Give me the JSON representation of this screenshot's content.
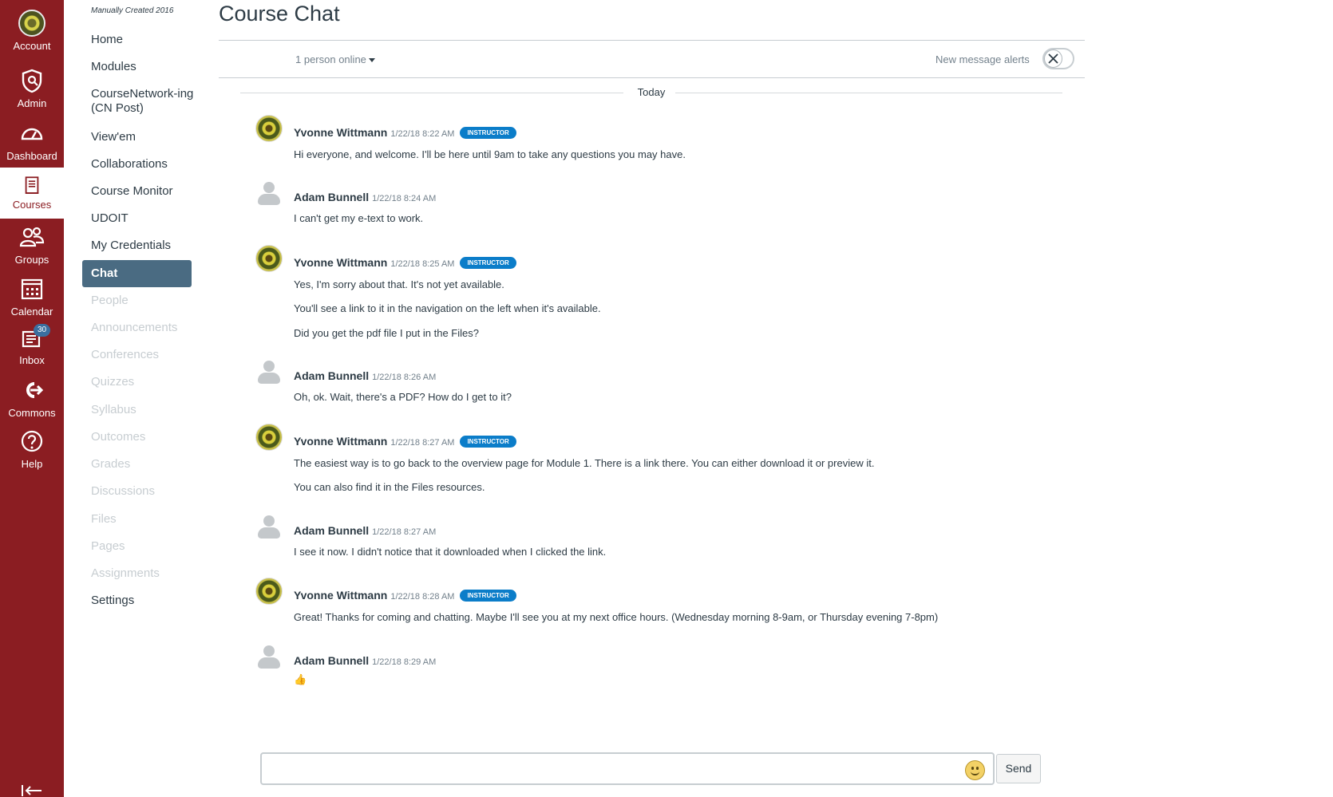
{
  "global_nav": {
    "items": [
      {
        "label": "Account",
        "icon": "account-avatar"
      },
      {
        "label": "Admin",
        "icon": "shield-icon"
      },
      {
        "label": "Dashboard",
        "icon": "dashboard-icon"
      },
      {
        "label": "Courses",
        "icon": "book-icon"
      },
      {
        "label": "Groups",
        "icon": "groups-icon"
      },
      {
        "label": "Calendar",
        "icon": "calendar-icon"
      },
      {
        "label": "Inbox",
        "icon": "inbox-icon",
        "badge": "30"
      },
      {
        "label": "Commons",
        "icon": "commons-icon"
      },
      {
        "label": "Help",
        "icon": "help-icon"
      }
    ],
    "active": "Courses",
    "color": "#8b1d22"
  },
  "course_nav": {
    "caption": "Manually Created 2016",
    "items": [
      {
        "label": "Home"
      },
      {
        "label": "Modules"
      },
      {
        "label": "CourseNetwork-ing (CN Post)"
      },
      {
        "label": "View'em"
      },
      {
        "label": "Collaborations"
      },
      {
        "label": "Course Monitor"
      },
      {
        "label": "UDOIT"
      },
      {
        "label": "My Credentials"
      },
      {
        "label": "Chat"
      },
      {
        "label": "People"
      },
      {
        "label": "Announcements"
      },
      {
        "label": "Conferences"
      },
      {
        "label": "Quizzes"
      },
      {
        "label": "Syllabus"
      },
      {
        "label": "Outcomes"
      },
      {
        "label": "Grades"
      },
      {
        "label": "Discussions"
      },
      {
        "label": "Files"
      },
      {
        "label": "Pages"
      },
      {
        "label": "Assignments"
      },
      {
        "label": "Settings"
      }
    ],
    "active": "Chat",
    "active_color": "#4a6b82"
  },
  "chat": {
    "title": "Course Chat",
    "online": "1 person online",
    "alerts_label": "New message alerts",
    "day_divider": "Today",
    "messages": [
      {
        "name": "Yvonne Wittmann",
        "time": "1/22/18 8:22 AM",
        "role": "INSTRUCTOR",
        "lines": [
          "Hi everyone, and welcome. I'll be here until 9am to take any questions you may have."
        ]
      },
      {
        "name": "Adam Bunnell",
        "time": "1/22/18 8:24 AM",
        "role": "",
        "lines": [
          "I can't get my e-text to work."
        ]
      },
      {
        "name": "Yvonne Wittmann",
        "time": "1/22/18 8:25 AM",
        "role": "INSTRUCTOR",
        "lines": [
          "Yes, I'm sorry about that. It's not yet available.",
          "You'll see a link to it in the navigation on the left when it's available.",
          "Did you get the pdf file I put in the Files?"
        ]
      },
      {
        "name": "Adam Bunnell",
        "time": "1/22/18 8:26 AM",
        "role": "",
        "lines": [
          "Oh, ok. Wait, there's a PDF? How do I get to it?"
        ]
      },
      {
        "name": "Yvonne Wittmann",
        "time": "1/22/18 8:27 AM",
        "role": "INSTRUCTOR",
        "lines": [
          "The easiest way is to go back to the overview page for Module 1. There is a link there. You can either download it or preview it.",
          "You can also find it in the Files resources."
        ]
      },
      {
        "name": "Adam Bunnell",
        "time": "1/22/18 8:27 AM",
        "role": "",
        "lines": [
          "I see it now. I didn't notice that it downloaded when I clicked the link."
        ]
      },
      {
        "name": "Yvonne Wittmann",
        "time": "1/22/18 8:28 AM",
        "role": "INSTRUCTOR",
        "lines": [
          "Great! Thanks for coming and chatting. Maybe I'll see you at my next office hours. (Wednesday morning 8-9am, or Thursday evening 7-8pm)"
        ]
      },
      {
        "name": "Adam Bunnell",
        "time": "1/22/18 8:29 AM",
        "role": "",
        "lines": [
          "👍"
        ]
      }
    ],
    "composer_value": "",
    "send_label": "Send",
    "role_color": "#0b7dc9"
  }
}
